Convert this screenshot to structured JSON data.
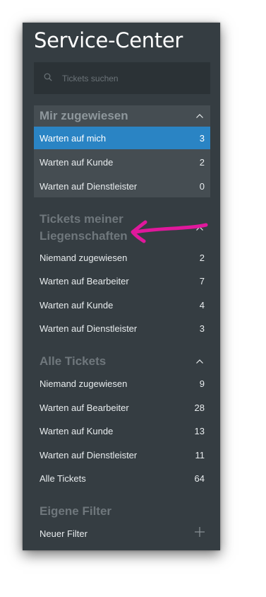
{
  "title": "Service-Center",
  "search": {
    "placeholder": "Tickets suchen"
  },
  "sections": [
    {
      "title": "Mir zugewiesen",
      "collapse_icon": "chevron-up-icon",
      "items": [
        {
          "label": "Warten auf mich",
          "count": "3",
          "active": true
        },
        {
          "label": "Warten auf Kunde",
          "count": "2"
        },
        {
          "label": "Warten auf Dienstleister",
          "count": "0"
        }
      ]
    },
    {
      "title_line1": "Tickets meiner",
      "title_line2": "Liegenschaften",
      "collapse_icon": "chevron-up-icon",
      "items": [
        {
          "label": "Niemand zugewiesen",
          "count": "2"
        },
        {
          "label": "Warten auf Bearbeiter",
          "count": "7"
        },
        {
          "label": "Warten auf Kunde",
          "count": "4"
        },
        {
          "label": "Warten auf Dienstleister",
          "count": "3"
        }
      ]
    },
    {
      "title": "Alle Tickets",
      "collapse_icon": "chevron-up-icon",
      "items": [
        {
          "label": "Niemand zugewiesen",
          "count": "9"
        },
        {
          "label": "Warten auf Bearbeiter",
          "count": "28"
        },
        {
          "label": "Warten auf Kunde",
          "count": "13"
        },
        {
          "label": "Warten auf Dienstleister",
          "count": "11"
        },
        {
          "label": "Alle Tickets",
          "count": "64"
        }
      ]
    },
    {
      "title": "Eigene Filter",
      "items": [
        {
          "label": "Neuer Filter",
          "action_icon": "plus-icon"
        }
      ]
    }
  ],
  "colors": {
    "panel_bg": "#353d42",
    "group_bg": "#454d52",
    "active_bg": "#2a84c4",
    "annotation_arrow": "#e0189c"
  }
}
